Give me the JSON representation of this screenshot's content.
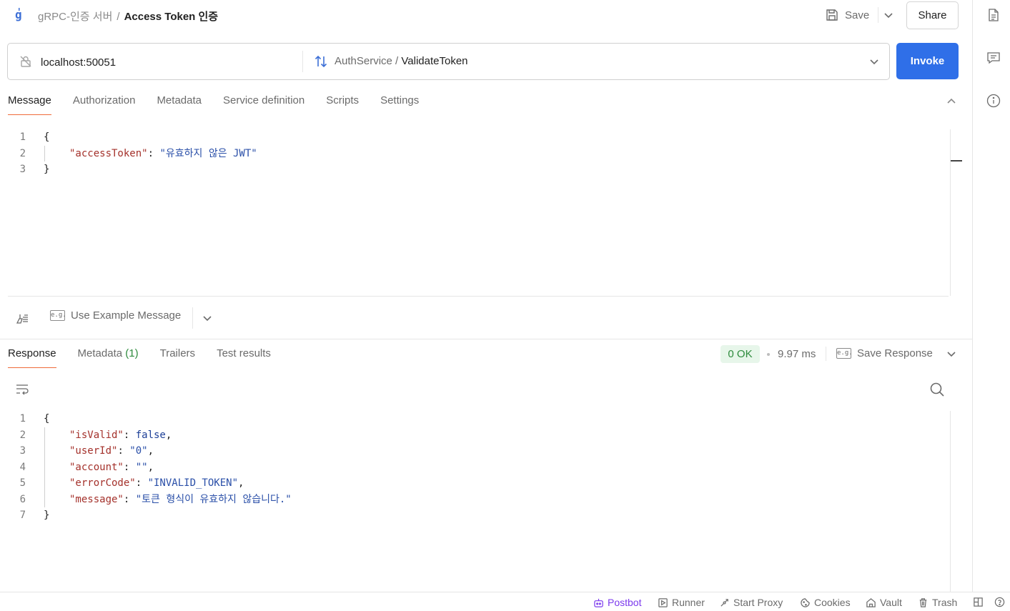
{
  "header": {
    "collection": "gRPC-인증 서버",
    "separator": "/",
    "request_name": "Access Token 인증",
    "save_label": "Save",
    "share_label": "Share"
  },
  "urlbar": {
    "url": "localhost:50051",
    "service": "AuthService",
    "method_sep": " / ",
    "method": "ValidateToken",
    "invoke_label": "Invoke"
  },
  "request_tabs": [
    "Message",
    "Authorization",
    "Metadata",
    "Service definition",
    "Scripts",
    "Settings"
  ],
  "request_active_tab": "Message",
  "request_message": {
    "line_numbers": [
      "1",
      "2",
      "3"
    ],
    "open": "{",
    "key": "\"accessToken\"",
    "colon": ": ",
    "value": "\"유효하지 않은 JWT\"",
    "close": "}"
  },
  "example_message_label": "Use Example Message",
  "eg_badge": "e.g.",
  "response_tabs": {
    "response": "Response",
    "metadata": "Metadata",
    "metadata_count": "(1)",
    "trailers": "Trailers",
    "test_results": "Test results"
  },
  "response_status": {
    "status": "0 OK",
    "time": "9.97 ms",
    "save_response_label": "Save Response"
  },
  "response_body": {
    "line_numbers": [
      "1",
      "2",
      "3",
      "4",
      "5",
      "6",
      "7"
    ],
    "open": "{",
    "close": "}",
    "fields": [
      {
        "key": "\"isValid\"",
        "value": "false",
        "trail": ","
      },
      {
        "key": "\"userId\"",
        "value": "\"0\"",
        "trail": ","
      },
      {
        "key": "\"account\"",
        "value": "\"\"",
        "trail": ","
      },
      {
        "key": "\"errorCode\"",
        "value": "\"INVALID_TOKEN\"",
        "trail": ","
      },
      {
        "key": "\"message\"",
        "value": "\"토큰 형식이 유효하지 않습니다.\"",
        "trail": ""
      }
    ]
  },
  "statusbar": {
    "postbot": "Postbot",
    "runner": "Runner",
    "start_proxy": "Start Proxy",
    "cookies": "Cookies",
    "vault": "Vault",
    "trash": "Trash"
  },
  "colors": {
    "accent": "#2f6fe8",
    "tab_underline": "#ef6b3a",
    "ok_green": "#2e8b3d",
    "json_key": "#a4312b",
    "json_string": "#2a4fa8"
  },
  "icons": [
    "grpc-icon",
    "save-icon",
    "chevron-down-icon",
    "no-lock-icon",
    "bidirectional-arrows-icon",
    "chevron-up-icon",
    "clean-icon",
    "eg-icon",
    "wrap-lines-icon",
    "search-icon",
    "document-icon",
    "comment-icon",
    "info-icon",
    "postbot-icon",
    "runner-icon",
    "proxy-icon",
    "cookie-icon",
    "vault-icon",
    "trash-icon",
    "layout-icon",
    "help-icon"
  ]
}
